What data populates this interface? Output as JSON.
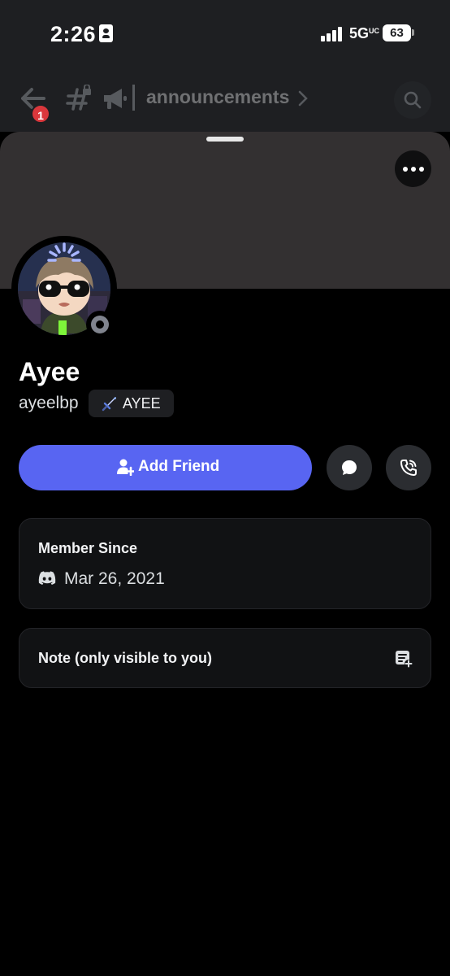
{
  "status_bar": {
    "time": "2:26",
    "network": "5G",
    "network_suffix": "UC",
    "battery": "63"
  },
  "channel_header": {
    "channel_name": "announcements",
    "unread_badge": "1"
  },
  "profile": {
    "display_name": "Ayee",
    "username": "ayeelbp",
    "tag": "AYEE",
    "status": "offline"
  },
  "actions": {
    "add_friend_label": "Add Friend"
  },
  "member_since": {
    "title": "Member Since",
    "date": "Mar 26, 2021"
  },
  "note": {
    "label": "Note (only visible to you)"
  },
  "colors": {
    "accent": "#5865f2",
    "sheet_bg": "#000000",
    "card_bg": "#111214",
    "banner": "#333031"
  },
  "icons": [
    "back-arrow-icon",
    "hashtag-lock-icon",
    "megaphone-icon",
    "chevron-right-icon",
    "search-icon",
    "more-icon",
    "sword-icon",
    "add-friend-icon",
    "chat-bubble-icon",
    "phone-icon",
    "discord-icon",
    "note-add-icon"
  ]
}
